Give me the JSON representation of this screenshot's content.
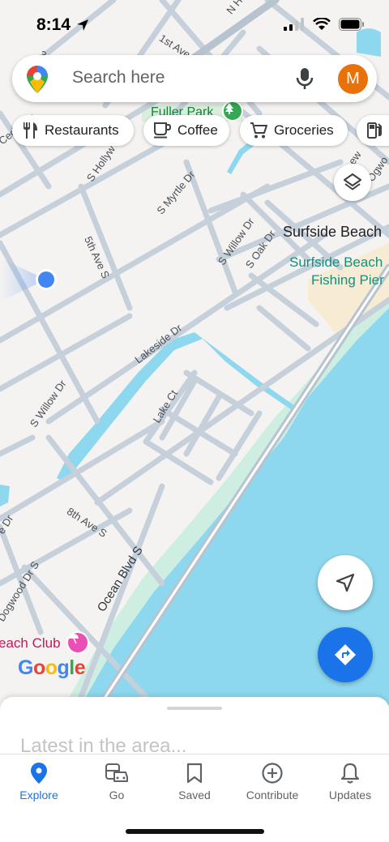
{
  "status": {
    "time": "8:14"
  },
  "search": {
    "placeholder": "Search here",
    "avatar_letter": "M"
  },
  "chips": [
    {
      "label": "Restaurants",
      "icon": "fork-knife-icon"
    },
    {
      "label": "Coffee",
      "icon": "coffee-cup-icon"
    },
    {
      "label": "Groceries",
      "icon": "cart-icon"
    },
    {
      "label": "Gas",
      "icon": "gas-pump-icon"
    }
  ],
  "map": {
    "streets": [
      "N Ho",
      "1st Ave N",
      "3rd",
      "Cedar Dr",
      "S Hollyw",
      "S Myrtle Dr",
      "5th Ave S",
      "S Willow Dr",
      "S Oak Dr",
      "Lakeside Dr",
      "S Willow Dr",
      "Lake Ct",
      "8th Ave S",
      "Ocean Blvd S",
      "Dogwood Dr S",
      "e Dr",
      "Ogwo",
      "ew"
    ],
    "places": {
      "fuller_park": "Fuller Park",
      "surfside_beach": "Surfside Beach",
      "fishing_pier_line1": "Surfside Beach",
      "fishing_pier_line2": "Fishing Pier",
      "beach_club": "each Club"
    },
    "attribution": "Google"
  },
  "sheet": {
    "title": "Latest in the area..."
  },
  "nav": [
    {
      "label": "Explore",
      "icon": "explore-pin-icon",
      "active": true
    },
    {
      "label": "Go",
      "icon": "commute-icon",
      "active": false
    },
    {
      "label": "Saved",
      "icon": "bookmark-icon",
      "active": false
    },
    {
      "label": "Contribute",
      "icon": "plus-circle-icon",
      "active": false
    },
    {
      "label": "Updates",
      "icon": "bell-icon",
      "active": false
    }
  ],
  "colors": {
    "accent": "#1a73e8",
    "water": "#8ed8ef",
    "beach": "#cdeee0",
    "pier": "#f7ecd3",
    "avatar": "#e8710a"
  }
}
